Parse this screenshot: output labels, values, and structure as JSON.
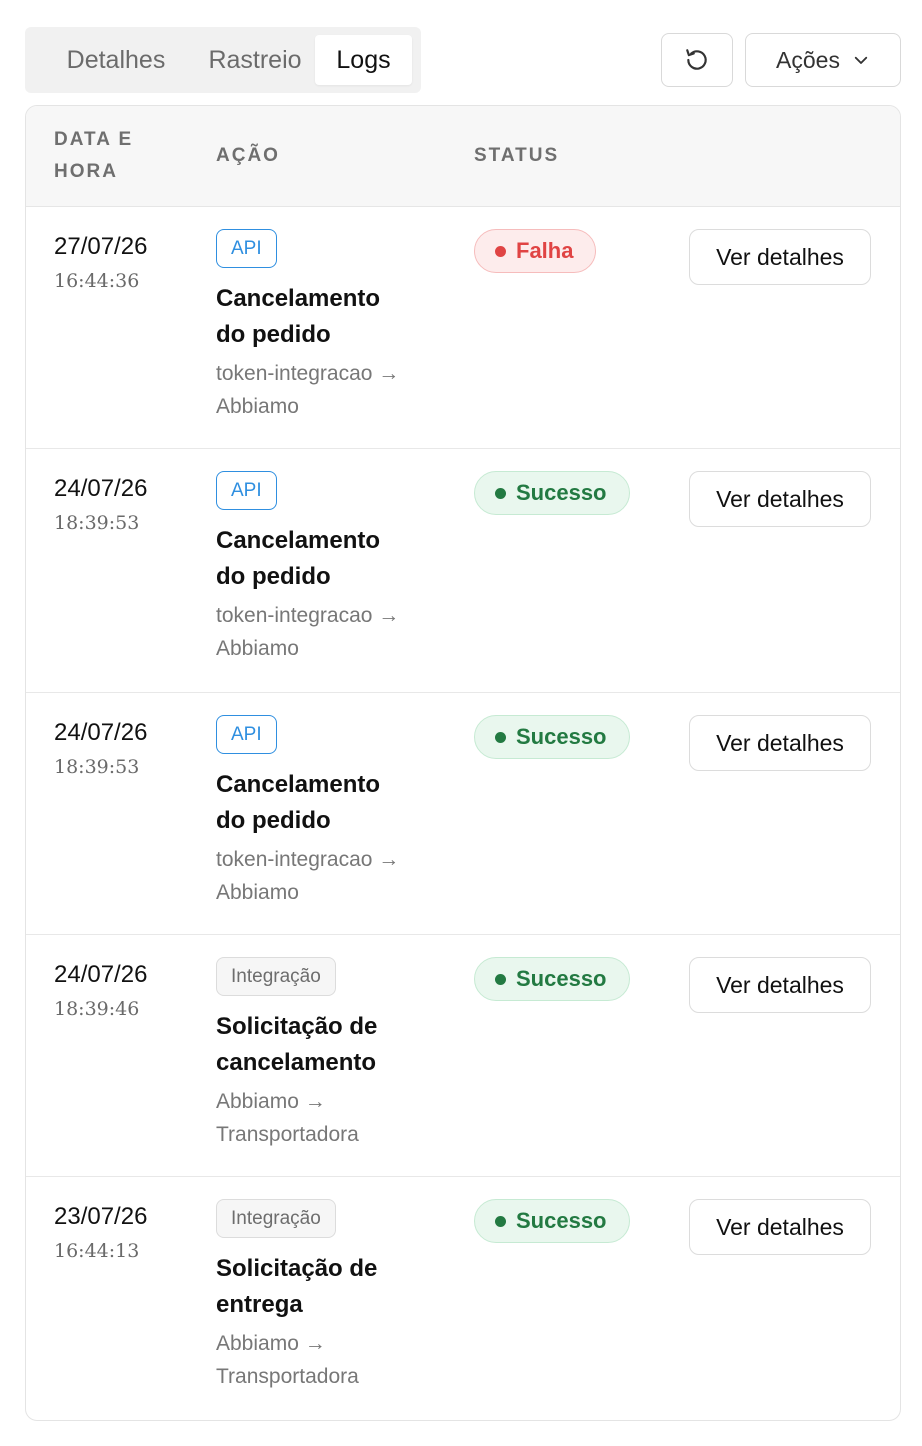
{
  "tabs": [
    {
      "label": "Detalhes",
      "active": false
    },
    {
      "label": "Rastreio",
      "active": false
    },
    {
      "label": "Logs",
      "active": true
    }
  ],
  "toolbar": {
    "refresh_icon": "refresh-icon",
    "actions_label": "Ações",
    "actions_icon": "chevron-down-icon"
  },
  "table": {
    "headers": {
      "date_line1": "DATA E",
      "date_line2": "HORA",
      "action": "AÇÃO",
      "status": "STATUS"
    },
    "rows": [
      {
        "date": "27/07/26",
        "time": "16:44:36",
        "tag": "API",
        "tag_type": "api",
        "title_line1": "Cancelamento",
        "title_line2": "do pedido",
        "route_line1": "token-integracao →",
        "route_line2": "Abbiamo",
        "status": "Falha",
        "status_type": "fail",
        "button": "Ver detalhes"
      },
      {
        "date": "24/07/26",
        "time": "18:39:53",
        "tag": "API",
        "tag_type": "api",
        "title_line1": "Cancelamento",
        "title_line2": "do pedido",
        "route_line1": "token-integracao →",
        "route_line2": "Abbiamo",
        "status": "Sucesso",
        "status_type": "ok",
        "button": "Ver detalhes"
      },
      {
        "date": "24/07/26",
        "time": "18:39:53",
        "tag": "API",
        "tag_type": "api",
        "title_line1": "Cancelamento",
        "title_line2": "do pedido",
        "route_line1": "token-integracao →",
        "route_line2": "Abbiamo",
        "status": "Sucesso",
        "status_type": "ok",
        "button": "Ver detalhes"
      },
      {
        "date": "24/07/26",
        "time": "18:39:46",
        "tag": "Integração",
        "tag_type": "integ",
        "title_line1": "Solicitação de",
        "title_line2": "cancelamento",
        "route_line1": "Abbiamo →",
        "route_line2": "Transportadora",
        "status": "Sucesso",
        "status_type": "ok",
        "button": "Ver detalhes"
      },
      {
        "date": "23/07/26",
        "time": "16:44:13",
        "tag": "Integração",
        "tag_type": "integ",
        "title_line1": "Solicitação de",
        "title_line2": "entrega",
        "route_line1": "Abbiamo →",
        "route_line2": "Transportadora",
        "status": "Sucesso",
        "status_type": "ok",
        "button": "Ver detalhes"
      }
    ]
  },
  "colors": {
    "api_tag": "#2f8fe0",
    "fail": "#e04444",
    "success": "#237a42"
  }
}
